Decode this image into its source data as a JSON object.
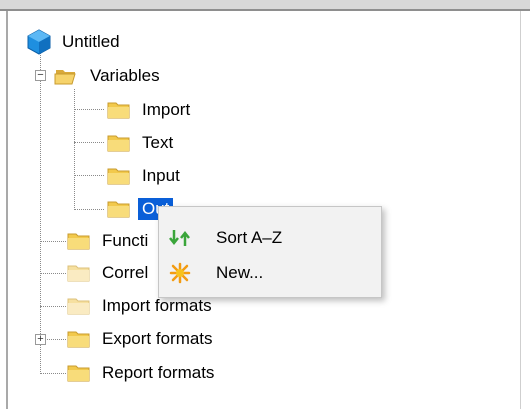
{
  "tree": {
    "root": {
      "label": "Untitled",
      "icon": "project-cube-icon"
    },
    "variables": {
      "label": "Variables",
      "icon": "open-folder-icon",
      "expanded": true,
      "children": [
        {
          "label": "Import"
        },
        {
          "label": "Text"
        },
        {
          "label": "Input"
        },
        {
          "label": "Output",
          "selected": true,
          "visible_label": "Out"
        }
      ]
    },
    "items": [
      {
        "label": "Functi"
      },
      {
        "label": "Correl"
      },
      {
        "label": "Import formats"
      },
      {
        "label": "Export formats",
        "expandable": true
      },
      {
        "label": "Report formats"
      }
    ]
  },
  "context_menu": {
    "items": [
      {
        "label": "Sort A–Z",
        "icon": "sort-arrows-icon"
      },
      {
        "label": "New...",
        "icon": "new-star-icon"
      }
    ]
  },
  "colors": {
    "selection": "#0a5fd8",
    "folder": "#f2c94c",
    "cube": "#1e8fe0"
  }
}
